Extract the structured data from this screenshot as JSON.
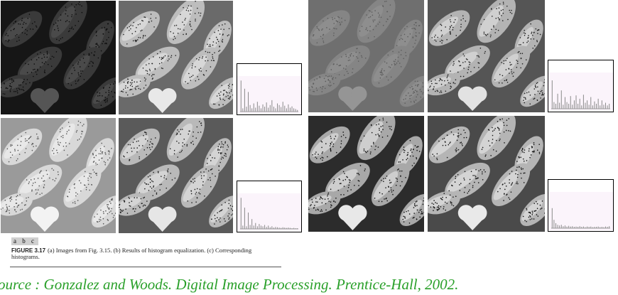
{
  "figure": {
    "panel_letters": "a b c",
    "caption_label": "FIGURE 3.17",
    "caption_text": "(a) Images from Fig. 3.15. (b) Results of histogram equalization. (c) Corresponding histograms."
  },
  "source_line": "ource : Gonzalez and Woods. Digital Image Processing. Prentice-Hall, 2002.",
  "colors": {
    "source_text": "#2aa02a",
    "histogram_bg": "#fbf4fb"
  },
  "images": [
    {
      "name": "dark-original",
      "bg": "#161616",
      "pod": "#3a3a3a",
      "pod_light": "#555555",
      "dots": "#0c0c0c"
    },
    {
      "name": "dark-equalized",
      "bg": "#6a6a6a",
      "pod": "#bdbdbd",
      "pod_light": "#e8e8e8",
      "dots": "#222222"
    },
    {
      "name": "bright-original",
      "bg": "#9a9a9a",
      "pod": "#d8d8d8",
      "pod_light": "#f3f3f3",
      "dots": "#555555"
    },
    {
      "name": "bright-equalized",
      "bg": "#5a5a5a",
      "pod": "#b9b9b9",
      "pod_light": "#e6e6e6",
      "dots": "#1c1c1c"
    },
    {
      "name": "lowcontrast-original",
      "bg": "#6f6f6f",
      "pod": "#858585",
      "pod_light": "#959595",
      "dots": "#5c5c5c"
    },
    {
      "name": "lowcontrast-equalized",
      "bg": "#555555",
      "pod": "#b3b3b3",
      "pod_light": "#e2e2e2",
      "dots": "#202020"
    },
    {
      "name": "highcontrast-original",
      "bg": "#2c2c2c",
      "pod": "#a8a8a8",
      "pod_light": "#e8e8e8",
      "dots": "#111111"
    },
    {
      "name": "highcontrast-equalized",
      "bg": "#4a4a4a",
      "pod": "#b5b5b5",
      "pod_light": "#e9e9e9",
      "dots": "#151515"
    }
  ],
  "histograms": [
    {
      "name": "histogram-dark-equalized",
      "values": [
        0.95,
        0.1,
        0.7,
        0.15,
        0.6,
        0.2,
        0.1,
        0.25,
        0.12,
        0.3,
        0.18,
        0.1,
        0.22,
        0.15,
        0.28,
        0.12,
        0.2,
        0.35,
        0.15,
        0.1,
        0.25,
        0.2,
        0.14,
        0.3,
        0.18,
        0.1,
        0.22,
        0.12,
        0.16,
        0.1,
        0.08,
        0.05
      ]
    },
    {
      "name": "histogram-bright-equalized",
      "values": [
        0.95,
        0.1,
        0.65,
        0.08,
        0.5,
        0.12,
        0.3,
        0.1,
        0.18,
        0.08,
        0.15,
        0.1,
        0.08,
        0.12,
        0.06,
        0.1,
        0.05,
        0.08,
        0.04,
        0.06,
        0.05,
        0.04,
        0.03,
        0.05,
        0.04,
        0.03,
        0.04,
        0.03,
        0.02,
        0.03,
        0.02,
        0.02
      ]
    },
    {
      "name": "histogram-lowcontrast-equalized",
      "values": [
        0.85,
        0.2,
        0.15,
        0.45,
        0.18,
        0.55,
        0.12,
        0.35,
        0.2,
        0.15,
        0.38,
        0.12,
        0.25,
        0.4,
        0.15,
        0.3,
        0.1,
        0.42,
        0.18,
        0.25,
        0.12,
        0.35,
        0.1,
        0.22,
        0.15,
        0.3,
        0.1,
        0.25,
        0.12,
        0.18,
        0.1,
        0.15
      ]
    },
    {
      "name": "histogram-highcontrast-equalized",
      "values": [
        0.6,
        0.25,
        0.15,
        0.1,
        0.08,
        0.1,
        0.06,
        0.08,
        0.05,
        0.07,
        0.05,
        0.06,
        0.04,
        0.05,
        0.04,
        0.06,
        0.04,
        0.05,
        0.03,
        0.05,
        0.04,
        0.05,
        0.03,
        0.04,
        0.04,
        0.05,
        0.03,
        0.04,
        0.03,
        0.05,
        0.04,
        0.06
      ]
    }
  ]
}
